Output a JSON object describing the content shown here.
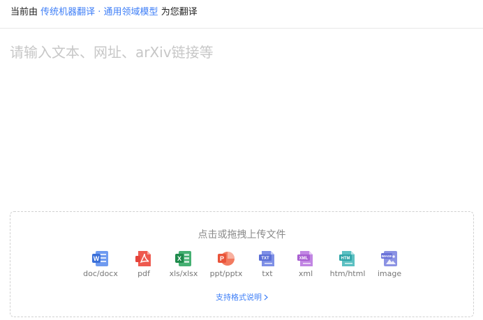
{
  "header": {
    "prefix": "当前由",
    "engine_link": "传统机器翻译 · 通用领域模型",
    "suffix": "为您翻译"
  },
  "input": {
    "placeholder": "请输入文本、网址、arXiv链接等",
    "value": ""
  },
  "upload": {
    "title": "点击或拖拽上传文件",
    "file_types": [
      {
        "label": "doc/docx",
        "icon": "word-doc-icon",
        "color": "#3a6fd8",
        "badge": "W"
      },
      {
        "label": "pdf",
        "icon": "pdf-icon",
        "color": "#e5443b",
        "badge": "PDF"
      },
      {
        "label": "xls/xlsx",
        "icon": "excel-icon",
        "color": "#1f8a4c",
        "badge": "X"
      },
      {
        "label": "ppt/pptx",
        "icon": "powerpoint-icon",
        "color": "#e9543a",
        "badge": "P"
      },
      {
        "label": "txt",
        "icon": "txt-file-icon",
        "color": "#5b6fd6",
        "badge": "TXT"
      },
      {
        "label": "xml",
        "icon": "xml-file-icon",
        "color": "#a95fd2",
        "badge": "XML"
      },
      {
        "label": "htm/html",
        "icon": "html-file-icon",
        "color": "#2fa5a8",
        "badge": "HTM"
      },
      {
        "label": "image",
        "icon": "image-file-icon",
        "color": "#6a72d8",
        "badge": "IMAGE"
      }
    ],
    "formats_link": "支持格式说明"
  },
  "colors": {
    "accent": "#3d7ef7",
    "placeholder": "#c7c7c7",
    "muted_text": "#777777"
  }
}
